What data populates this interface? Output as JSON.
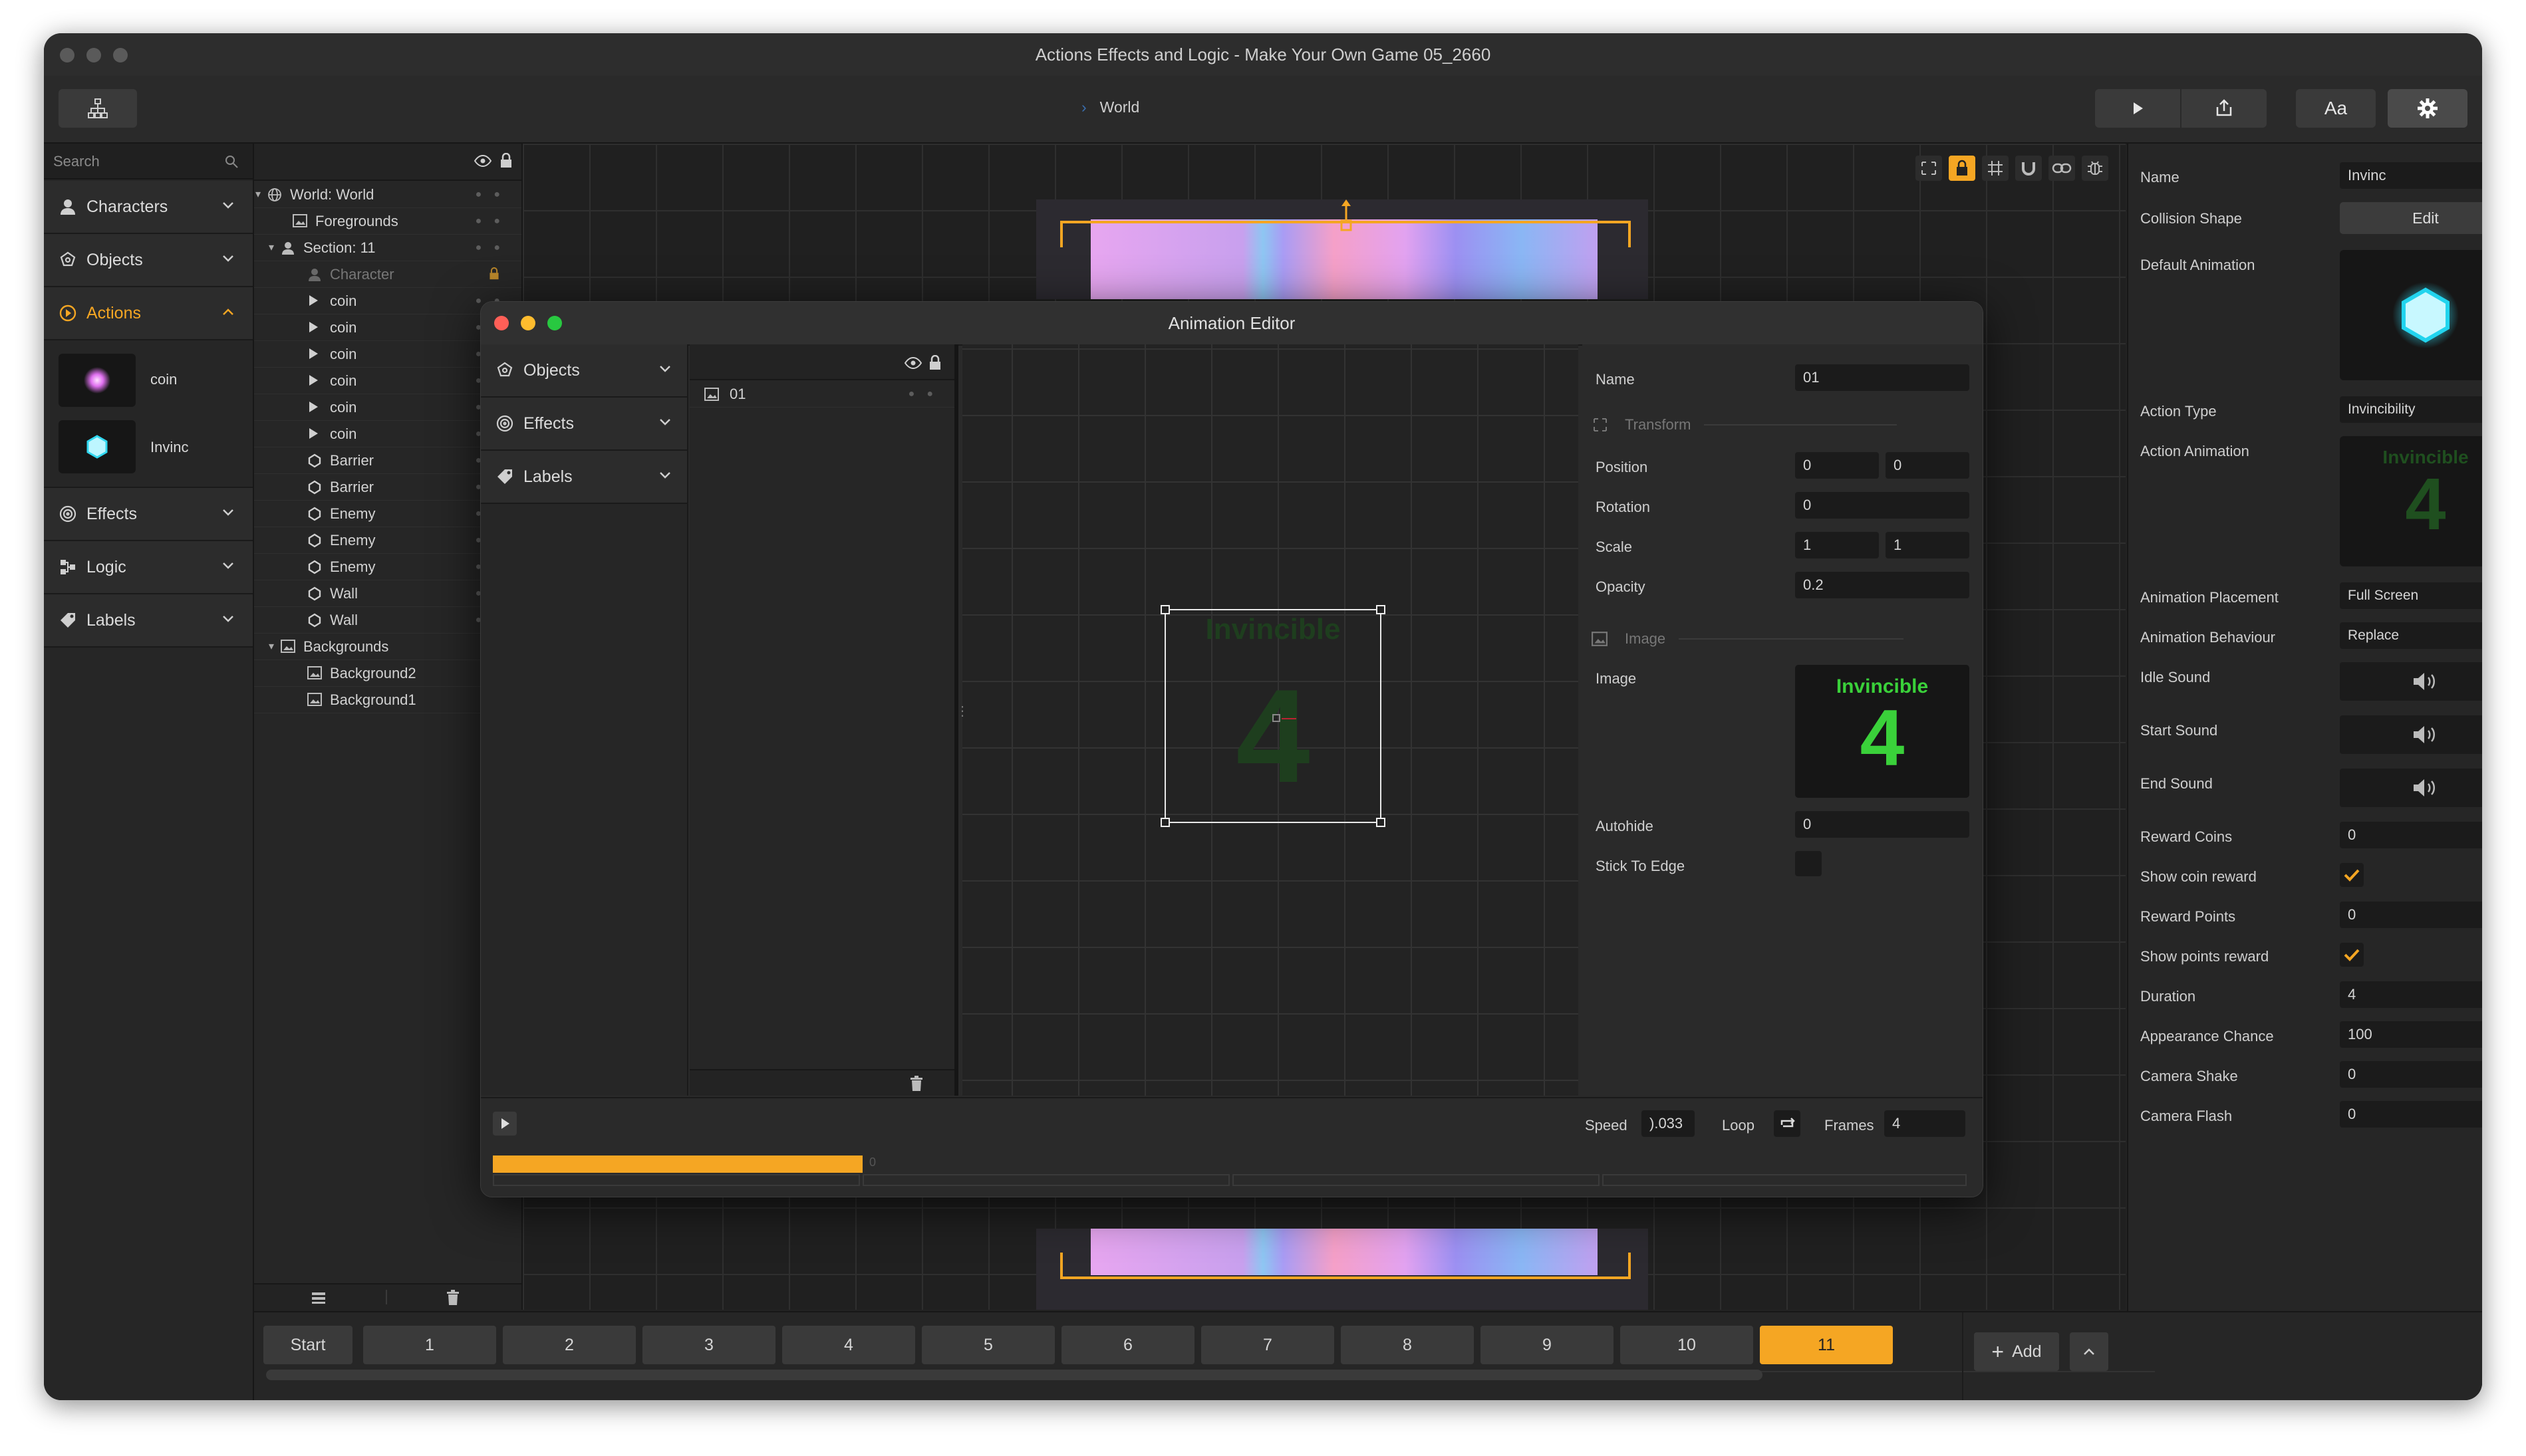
{
  "window": {
    "title": "Actions Effects and Logic - Make Your Own Game 05_2660",
    "breadcrumb": "World",
    "toolbar": {
      "font_button": "Aa"
    }
  },
  "sidebar": {
    "search_placeholder": "Search",
    "categories": [
      {
        "label": "Characters",
        "icon": "person-icon"
      },
      {
        "label": "Objects",
        "icon": "objects-icon"
      },
      {
        "label": "Actions",
        "icon": "play-circle-icon",
        "expanded": true,
        "color": "#f5a623"
      },
      {
        "label": "Effects",
        "icon": "spiral-icon"
      },
      {
        "label": "Logic",
        "icon": "logic-icon"
      },
      {
        "label": "Labels",
        "icon": "tag-icon"
      }
    ],
    "actions_items": [
      {
        "label": "coin"
      },
      {
        "label": "Invinc"
      }
    ]
  },
  "tree": {
    "rows": [
      {
        "label": "World: World"
      },
      {
        "label": "Foregrounds"
      },
      {
        "label": "Section: 11"
      },
      {
        "label": "Character"
      },
      {
        "label": "coin"
      },
      {
        "label": "coin"
      },
      {
        "label": "coin"
      },
      {
        "label": "coin"
      },
      {
        "label": "coin"
      },
      {
        "label": "coin"
      },
      {
        "label": "Barrier"
      },
      {
        "label": "Barrier"
      },
      {
        "label": "Enemy"
      },
      {
        "label": "Enemy"
      },
      {
        "label": "Enemy"
      },
      {
        "label": "Wall"
      },
      {
        "label": "Wall"
      },
      {
        "label": "Backgrounds"
      },
      {
        "label": "Background2"
      },
      {
        "label": "Background1"
      }
    ]
  },
  "properties": {
    "name_label": "Name",
    "name_value": "Invinc",
    "collision_label": "Collision Shape",
    "collision_button": "Edit",
    "default_anim_label": "Default Animation",
    "action_type_label": "Action Type",
    "action_type_value": "Invincibility",
    "action_anim_label": "Action Animation",
    "anim_text": "Invincible",
    "anim_number": "4",
    "placement_label": "Animation Placement",
    "placement_value": "Full Screen",
    "behaviour_label": "Animation Behaviour",
    "behaviour_value": "Replace",
    "idle_sound_label": "Idle Sound",
    "start_sound_label": "Start Sound",
    "end_sound_label": "End Sound",
    "reward_coins_label": "Reward Coins",
    "reward_coins_value": "0",
    "show_coin_label": "Show coin reward",
    "reward_points_label": "Reward Points",
    "reward_points_value": "0",
    "show_points_label": "Show points reward",
    "duration_label": "Duration",
    "duration_value": "4",
    "chance_label": "Appearance Chance",
    "chance_value": "100",
    "shake_label": "Camera Shake",
    "shake_value": "0",
    "flash_label": "Camera Flash",
    "flash_value": "0"
  },
  "sections": {
    "start": "Start",
    "numbers": [
      "1",
      "2",
      "3",
      "4",
      "5",
      "6",
      "7",
      "8",
      "9",
      "10",
      "11"
    ],
    "active": "11",
    "add": "Add"
  },
  "dialog": {
    "title": "Animation Editor",
    "categories": [
      {
        "label": "Objects"
      },
      {
        "label": "Effects"
      },
      {
        "label": "Labels"
      }
    ],
    "frame_item": "01",
    "preview_text": "Invincible",
    "preview_number": "4",
    "name_label": "Name",
    "name_value": "01",
    "transform_label": "Transform",
    "position_label": "Position",
    "position_x": "0",
    "position_y": "0",
    "rotation_label": "Rotation",
    "rotation_value": "0",
    "scale_label": "Scale",
    "scale_x": "1",
    "scale_y": "1",
    "opacity_label": "Opacity",
    "opacity_value": "0.2",
    "image_section": "Image",
    "image_label": "Image",
    "image_text": "Invincible",
    "image_number": "4",
    "autohide_label": "Autohide",
    "autohide_value": "0",
    "stick_label": "Stick To Edge",
    "speed_label": "Speed",
    "speed_value": ").033",
    "loop_label": "Loop",
    "frames_label": "Frames",
    "frames_value": "4",
    "timeline_marker": "0",
    "colors": {
      "accent": "#f5a623",
      "green": "#3ad13a"
    }
  }
}
